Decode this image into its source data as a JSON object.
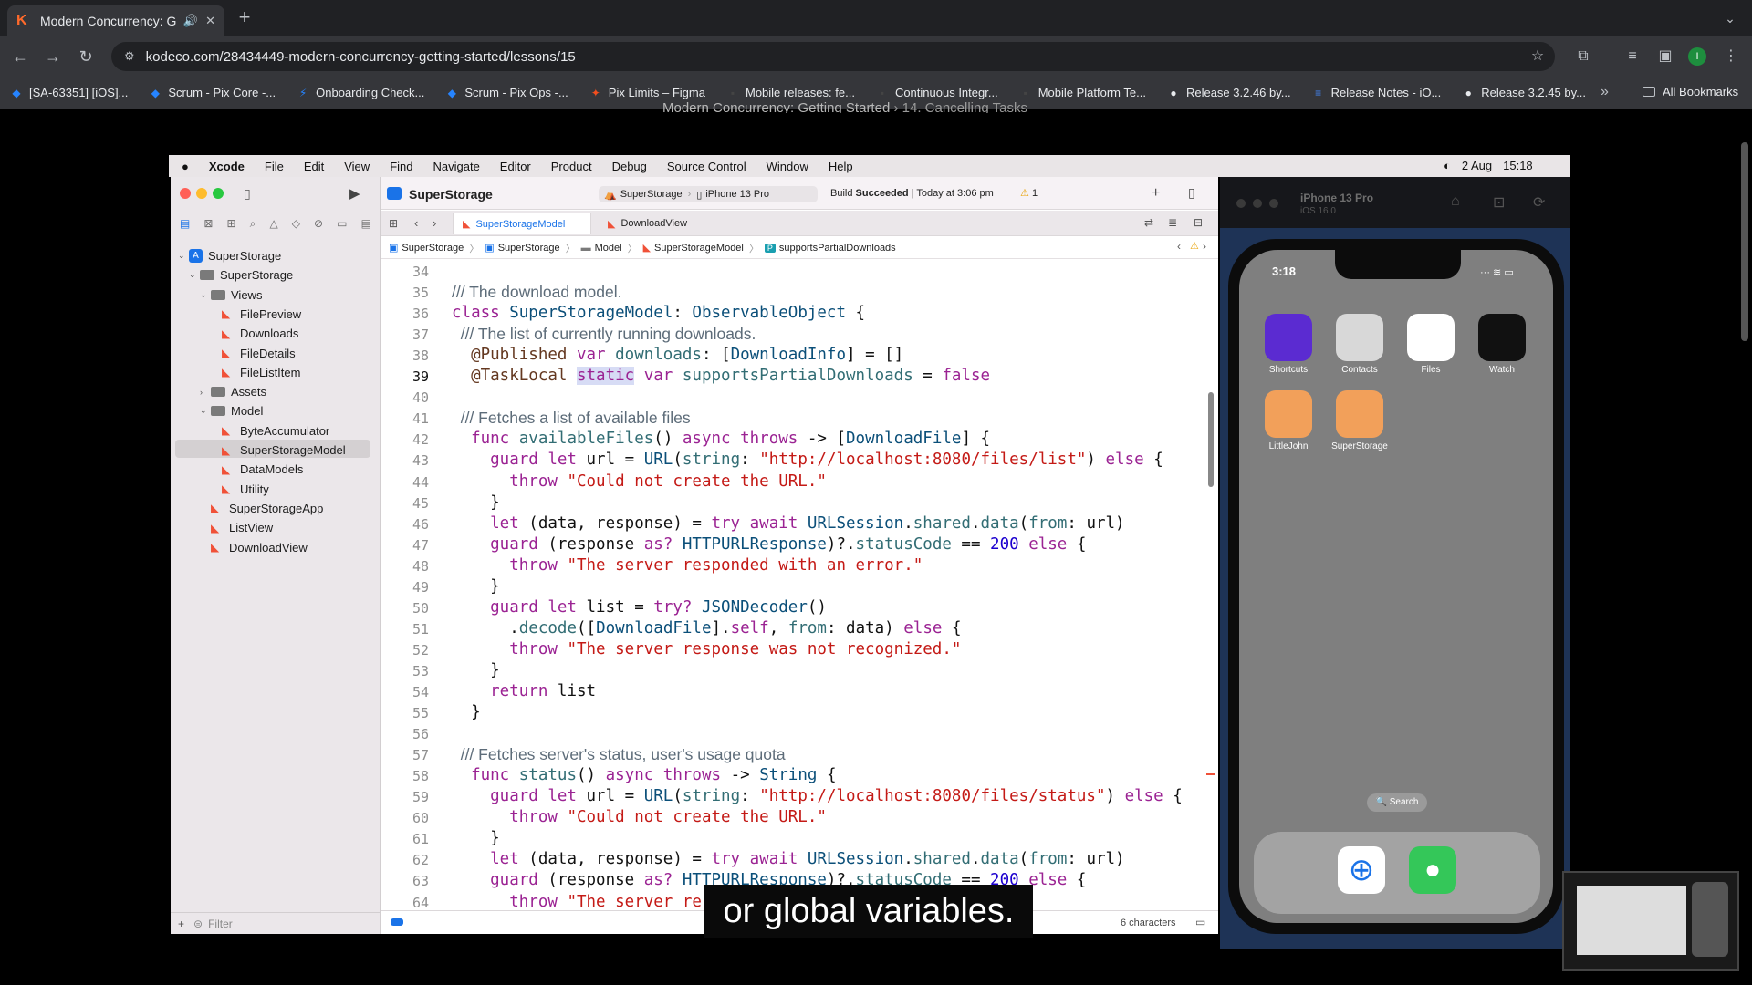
{
  "browser": {
    "tab_title": "Modern Concurrency: Getting Started",
    "url": "kodeco.com/28434449-modern-concurrency-getting-started/lessons/15",
    "profile_initial": "I",
    "bookmarks": [
      {
        "label": "[SA-63351] [iOS]...",
        "color": "#2684ff",
        "glyph": "◆"
      },
      {
        "label": "Scrum - Pix Core -...",
        "color": "#2684ff",
        "glyph": "◆"
      },
      {
        "label": "Onboarding Check...",
        "color": "#2684ff",
        "glyph": "⚡"
      },
      {
        "label": "Scrum - Pix Ops -...",
        "color": "#2684ff",
        "glyph": "◆"
      },
      {
        "label": "Pix Limits – Figma",
        "color": "#f24e1e",
        "glyph": "✦"
      },
      {
        "label": "Mobile releases: fe...",
        "color": "#444",
        "glyph": "▪"
      },
      {
        "label": "Continuous Integr...",
        "color": "#444",
        "glyph": "▪"
      },
      {
        "label": "Mobile Platform Te...",
        "color": "#444",
        "glyph": "▪"
      },
      {
        "label": "Release 3.2.46 by...",
        "color": "#e8eaed",
        "glyph": "●"
      },
      {
        "label": "Release Notes - iO...",
        "color": "#4285f4",
        "glyph": "≡"
      },
      {
        "label": "Release 3.2.45 by...",
        "color": "#e8eaed",
        "glyph": "●"
      }
    ],
    "all_bookmarks": "All Bookmarks",
    "more": "»"
  },
  "page": {
    "breadcrumb_course": "Modern Concurrency: Getting Started",
    "breadcrumb_sep": "›",
    "breadcrumb_lesson": "14. Cancelling Tasks",
    "caption": "or global variables."
  },
  "mac": {
    "menu": [
      "Xcode",
      "File",
      "Edit",
      "View",
      "Find",
      "Navigate",
      "Editor",
      "Product",
      "Debug",
      "Source Control",
      "Window",
      "Help"
    ],
    "date": "2 Aug",
    "time": "15:18"
  },
  "xcode": {
    "project_title": "SuperStorage",
    "scheme": "SuperStorage",
    "device": "iPhone 13 Pro",
    "build_label": "Build",
    "build_result": "Succeeded",
    "build_time": "| Today at 3:06 pm",
    "warnings": "1",
    "tabs": [
      "SuperStorageModel",
      "DownloadView"
    ],
    "breadcrumbs": [
      "SuperStorage",
      "SuperStorage",
      "Model",
      "SuperStorageModel",
      "supportsPartialDownloads"
    ],
    "filter_placeholder": "Filter",
    "char_count": "6 characters",
    "tree": [
      {
        "label": "SuperStorage",
        "kind": "proj",
        "depth": 0,
        "chev": "⌄"
      },
      {
        "label": "SuperStorage",
        "kind": "folder",
        "depth": 1,
        "chev": "⌄"
      },
      {
        "label": "Views",
        "kind": "folder",
        "depth": 2,
        "chev": "⌄"
      },
      {
        "label": "FilePreview",
        "kind": "swift",
        "depth": 3,
        "chev": ""
      },
      {
        "label": "Downloads",
        "kind": "swift",
        "depth": 3,
        "chev": ""
      },
      {
        "label": "FileDetails",
        "kind": "swift",
        "depth": 3,
        "chev": ""
      },
      {
        "label": "FileListItem",
        "kind": "swift",
        "depth": 3,
        "chev": ""
      },
      {
        "label": "Assets",
        "kind": "folder",
        "depth": 2,
        "chev": "›"
      },
      {
        "label": "Model",
        "kind": "folder",
        "depth": 2,
        "chev": "⌄"
      },
      {
        "label": "ByteAccumulator",
        "kind": "swift",
        "depth": 3,
        "chev": ""
      },
      {
        "label": "SuperStorageModel",
        "kind": "swift",
        "depth": 3,
        "chev": ""
      },
      {
        "label": "DataModels",
        "kind": "swift",
        "depth": 3,
        "chev": ""
      },
      {
        "label": "Utility",
        "kind": "swift",
        "depth": 3,
        "chev": ""
      },
      {
        "label": "SuperStorageApp",
        "kind": "swift",
        "depth": 2,
        "chev": ""
      },
      {
        "label": "ListView",
        "kind": "swift",
        "depth": 2,
        "chev": ""
      },
      {
        "label": "DownloadView",
        "kind": "swift",
        "depth": 2,
        "chev": ""
      }
    ],
    "current_line": 39,
    "code": [
      {
        "n": 34,
        "t": []
      },
      {
        "n": 35,
        "t": [
          [
            "cm",
            "/// The download model."
          ]
        ]
      },
      {
        "n": 36,
        "t": [
          [
            "kw",
            "class "
          ],
          [
            "ty",
            "SuperStorageModel"
          ],
          [
            "",
            ": "
          ],
          [
            "ty",
            "ObservableObject"
          ],
          [
            "",
            " {"
          ]
        ]
      },
      {
        "n": 37,
        "t": [
          [
            "cm",
            "  /// The list of currently running downloads."
          ]
        ]
      },
      {
        "n": 38,
        "t": [
          [
            "pp",
            "  @Published "
          ],
          [
            "kw",
            "var "
          ],
          [
            "fn",
            "downloads"
          ],
          [
            "",
            ": ["
          ],
          [
            "ty",
            "DownloadInfo"
          ],
          [
            "",
            "] = []"
          ]
        ]
      },
      {
        "n": 39,
        "t": [
          [
            "pp",
            "  @TaskLocal "
          ],
          [
            "kwhl",
            "static"
          ],
          [
            "kw",
            " var "
          ],
          [
            "fn",
            "supportsPartialDownloads"
          ],
          [
            "",
            " = "
          ],
          [
            "kw",
            "false"
          ]
        ]
      },
      {
        "n": 40,
        "t": []
      },
      {
        "n": 41,
        "t": [
          [
            "cm",
            "  /// Fetches a list of available files"
          ]
        ]
      },
      {
        "n": 42,
        "t": [
          [
            "kw",
            "  func "
          ],
          [
            "fn",
            "availableFiles"
          ],
          [
            "",
            "() "
          ],
          [
            "kw",
            "async throws"
          ],
          [
            "",
            " -> ["
          ],
          [
            "ty",
            "DownloadFile"
          ],
          [
            "",
            "] {"
          ]
        ]
      },
      {
        "n": 43,
        "t": [
          [
            "kw",
            "    guard let "
          ],
          [
            "",
            "url = "
          ],
          [
            "ty",
            "URL"
          ],
          [
            "",
            "("
          ],
          [
            "fn",
            "string"
          ],
          [
            "",
            ": "
          ],
          [
            "st",
            "\"http://localhost:8080/files/list\""
          ],
          [
            "",
            ") "
          ],
          [
            "kw",
            "else"
          ],
          [
            "",
            " {"
          ]
        ]
      },
      {
        "n": 44,
        "t": [
          [
            "kw",
            "      throw "
          ],
          [
            "st",
            "\"Could not create the URL.\""
          ]
        ]
      },
      {
        "n": 45,
        "t": [
          [
            "",
            "    }"
          ]
        ]
      },
      {
        "n": 46,
        "t": [
          [
            "kw",
            "    let "
          ],
          [
            "",
            "(data, response) = "
          ],
          [
            "kw",
            "try await "
          ],
          [
            "ty",
            "URLSession"
          ],
          [
            "",
            "."
          ],
          [
            "fn",
            "shared"
          ],
          [
            "",
            "."
          ],
          [
            "fn",
            "data"
          ],
          [
            "",
            "("
          ],
          [
            "fn",
            "from"
          ],
          [
            "",
            ": url)"
          ]
        ]
      },
      {
        "n": 47,
        "t": [
          [
            "kw",
            "    guard "
          ],
          [
            "",
            "(response "
          ],
          [
            "kw",
            "as? "
          ],
          [
            "ty",
            "HTTPURLResponse"
          ],
          [
            "",
            ")?."
          ],
          [
            "fn",
            "statusCode"
          ],
          [
            "",
            " == "
          ],
          [
            "nu",
            "200"
          ],
          [
            "kw",
            " else"
          ],
          [
            "",
            " {"
          ]
        ]
      },
      {
        "n": 48,
        "t": [
          [
            "kw",
            "      throw "
          ],
          [
            "st",
            "\"The server responded with an error.\""
          ]
        ]
      },
      {
        "n": 49,
        "t": [
          [
            "",
            "    }"
          ]
        ]
      },
      {
        "n": 50,
        "t": [
          [
            "kw",
            "    guard let "
          ],
          [
            "",
            "list = "
          ],
          [
            "kw",
            "try? "
          ],
          [
            "ty",
            "JSONDecoder"
          ],
          [
            "",
            "()"
          ]
        ]
      },
      {
        "n": 51,
        "t": [
          [
            "",
            "      ."
          ],
          [
            "fn",
            "decode"
          ],
          [
            "",
            "(["
          ],
          [
            "ty",
            "DownloadFile"
          ],
          [
            "",
            "]."
          ],
          [
            "kw",
            "self"
          ],
          [
            "",
            ", "
          ],
          [
            "fn",
            "from"
          ],
          [
            "",
            ": data) "
          ],
          [
            "kw",
            "else"
          ],
          [
            "",
            " {"
          ]
        ]
      },
      {
        "n": 52,
        "t": [
          [
            "kw",
            "      throw "
          ],
          [
            "st",
            "\"The server response was not recognized.\""
          ]
        ]
      },
      {
        "n": 53,
        "t": [
          [
            "",
            "    }"
          ]
        ]
      },
      {
        "n": 54,
        "t": [
          [
            "kw",
            "    return "
          ],
          [
            "",
            "list"
          ]
        ]
      },
      {
        "n": 55,
        "t": [
          [
            "",
            "  }"
          ]
        ]
      },
      {
        "n": 56,
        "t": []
      },
      {
        "n": 57,
        "t": [
          [
            "cm",
            "  /// Fetches server's status, user's usage quota"
          ]
        ]
      },
      {
        "n": 58,
        "t": [
          [
            "kw",
            "  func "
          ],
          [
            "fn",
            "status"
          ],
          [
            "",
            "() "
          ],
          [
            "kw",
            "async throws"
          ],
          [
            "",
            " -> "
          ],
          [
            "ty",
            "String"
          ],
          [
            "",
            " {"
          ]
        ]
      },
      {
        "n": 59,
        "t": [
          [
            "kw",
            "    guard let "
          ],
          [
            "",
            "url = "
          ],
          [
            "ty",
            "URL"
          ],
          [
            "",
            "("
          ],
          [
            "fn",
            "string"
          ],
          [
            "",
            ": "
          ],
          [
            "st",
            "\"http://localhost:8080/files/status\""
          ],
          [
            "",
            ") "
          ],
          [
            "kw",
            "else"
          ],
          [
            "",
            " {"
          ]
        ]
      },
      {
        "n": 60,
        "t": [
          [
            "kw",
            "      throw "
          ],
          [
            "st",
            "\"Could not create the URL.\""
          ]
        ]
      },
      {
        "n": 61,
        "t": [
          [
            "",
            "    }"
          ]
        ]
      },
      {
        "n": 62,
        "t": [
          [
            "kw",
            "    let "
          ],
          [
            "",
            "(data, response) = "
          ],
          [
            "kw",
            "try await "
          ],
          [
            "ty",
            "URLSession"
          ],
          [
            "",
            "."
          ],
          [
            "fn",
            "shared"
          ],
          [
            "",
            "."
          ],
          [
            "fn",
            "data"
          ],
          [
            "",
            "("
          ],
          [
            "fn",
            "from"
          ],
          [
            "",
            ": url)"
          ]
        ]
      },
      {
        "n": 63,
        "t": [
          [
            "kw",
            "    guard "
          ],
          [
            "",
            "(response "
          ],
          [
            "kw",
            "as? "
          ],
          [
            "ty",
            "HTTPURLResponse"
          ],
          [
            "",
            ")?."
          ],
          [
            "fn",
            "statusCode"
          ],
          [
            "",
            " == "
          ],
          [
            "nu",
            "200"
          ],
          [
            "kw",
            " else"
          ],
          [
            "",
            " {"
          ]
        ]
      },
      {
        "n": 64,
        "t": [
          [
            "kw",
            "      throw "
          ],
          [
            "st",
            "\"The server re"
          ]
        ]
      }
    ]
  },
  "simulator": {
    "title": "iPhone 13 Pro",
    "subtitle": "iOS 16.0",
    "time": "3:18",
    "search": "🔍 Search",
    "apps": [
      {
        "label": "Shortcuts",
        "color": "#5b2bd1"
      },
      {
        "label": "Contacts",
        "color": "#d8d8d8"
      },
      {
        "label": "Files",
        "color": "#ffffff"
      },
      {
        "label": "Watch",
        "color": "#111111"
      },
      {
        "label": "LittleJohn",
        "color": "#f2a05a"
      },
      {
        "label": "SuperStorage",
        "color": "#f2a05a"
      }
    ]
  }
}
